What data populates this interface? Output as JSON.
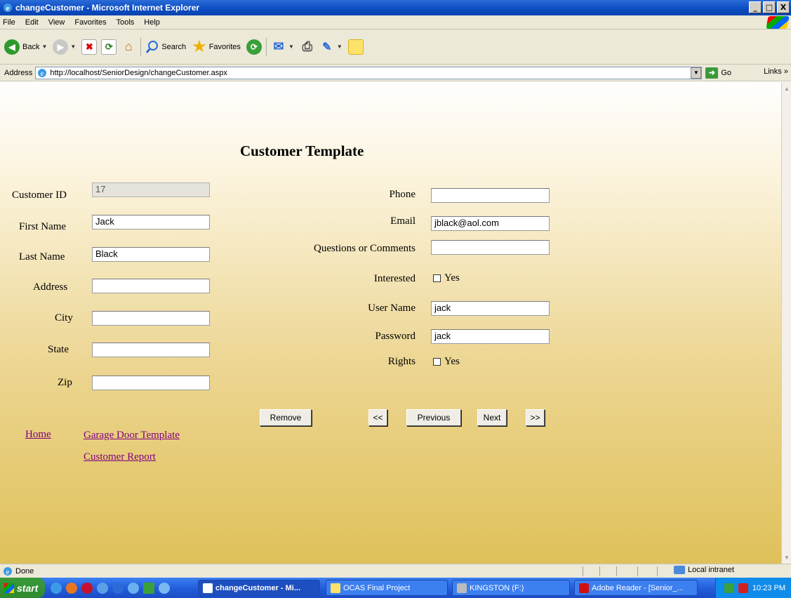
{
  "window": {
    "title": "changeCustomer - Microsoft Internet Explorer",
    "min": "_",
    "max": "□",
    "close": "X"
  },
  "menu": [
    "File",
    "Edit",
    "View",
    "Favorites",
    "Tools",
    "Help"
  ],
  "toolbar": {
    "back": "Back",
    "search": "Search",
    "favorites": "Favorites"
  },
  "address": {
    "label": "Address",
    "url": "http://localhost/SeniorDesign/changeCustomer.aspx",
    "go": "Go",
    "links": "Links"
  },
  "form": {
    "heading": "Customer Template",
    "labels": {
      "customer_id": "Customer ID",
      "first_name": "First Name",
      "last_name": "Last Name",
      "address": "Address",
      "city": "City",
      "state": "State",
      "zip": "Zip",
      "phone": "Phone",
      "email": "Email",
      "comments": "Questions or Comments",
      "interested": "Interested",
      "user_name": "User Name",
      "password": "Password",
      "rights": "Rights"
    },
    "values": {
      "customer_id": "17",
      "first_name": "Jack",
      "last_name": "Black",
      "address": "",
      "city": "",
      "state": "",
      "zip": "",
      "phone": "",
      "email": "jblack@aol.com",
      "comments": "",
      "user_name": "jack",
      "password": "jack"
    },
    "checkbox_label": "Yes",
    "interested_checked": false,
    "rights_checked": false,
    "buttons": {
      "remove": "Remove",
      "first": "<<",
      "previous": "Previous",
      "next": "Next",
      "last": ">>"
    }
  },
  "links": {
    "home": "Home",
    "garage_door": "Garage Door Template",
    "customer_report": "Customer Report"
  },
  "status": {
    "text": "Done",
    "zone": "Local intranet"
  },
  "taskbar": {
    "start": "start",
    "tasks": [
      "changeCustomer - Mi...",
      "OCAS Final Project",
      "KINGSTON (F:)",
      "Adobe Reader - [Senior_..."
    ],
    "clock": "10:23 PM"
  }
}
